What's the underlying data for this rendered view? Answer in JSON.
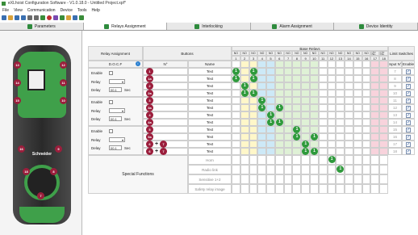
{
  "window": {
    "title": "eXLhoist Configuration Software - V1.0.18.0 - Untitled Project.xpf*"
  },
  "menu": [
    "File",
    "View",
    "Communication",
    "Device",
    "Tools",
    "Help"
  ],
  "toolbar": [
    "new-icon",
    "open-icon",
    "save-icon",
    "save-as-icon",
    "print-icon",
    "preview-icon",
    "export-icon",
    "stop-icon",
    "device-icon",
    "config-icon",
    "refresh-icon",
    "help-icon",
    "info-icon"
  ],
  "tabs": [
    "Parameters",
    "Relays Assignment",
    "Interlocking",
    "Alarm Assignment",
    "Device Identity"
  ],
  "active_tab": 1,
  "remote": {
    "brand": "Schneider",
    "left_badges": [
      "13",
      "14",
      "15",
      "16",
      "18"
    ],
    "right_badges": [
      "12",
      "11",
      "10",
      "9",
      "8"
    ],
    "center_badge": "7"
  },
  "relay_assignment": {
    "header": "Relay Assignment",
    "doc_label": "D.O.C.F",
    "groups": [
      {
        "enable": "Enable",
        "relay": "Relay",
        "delay": "Delay",
        "delay_value": "00.1",
        "unit": "Sec"
      },
      {
        "enable": "Enable",
        "relay": "Relay",
        "delay": "Delay",
        "delay_value": "00.1",
        "unit": "Sec"
      },
      {
        "enable": "Enable",
        "relay": "Relay",
        "delay": "Delay",
        "delay_value": "00.1",
        "unit": "Sec"
      }
    ]
  },
  "buttons": {
    "header": "Buttons",
    "col_no": "N°",
    "col_name": "Name",
    "rows": [
      {
        "badge": "1",
        "name": "Text"
      },
      {
        "badge": "1a",
        "name": "Text"
      },
      {
        "badge": "2",
        "name": "Text"
      },
      {
        "badge": "2a",
        "name": "Text"
      },
      {
        "badge": "3",
        "name": "Text"
      },
      {
        "badge": "3a",
        "name": "Text"
      },
      {
        "badge": "4",
        "name": "Text"
      },
      {
        "badge": "4a",
        "name": "Text"
      },
      {
        "badge": "5",
        "name": "Text"
      },
      {
        "badge": "5a",
        "name": "Text"
      },
      {
        "badge": "6",
        "plus": "+",
        "badge2": "7",
        "name": "Text"
      },
      {
        "badge": "6",
        "plus": "+",
        "badge2": "7",
        "name": "Text"
      }
    ]
  },
  "base_relays": {
    "header": "Base Relays",
    "types": [
      "NO",
      "NO",
      "NO",
      "NO",
      "NO",
      "NO",
      "NO",
      "NO",
      "NO",
      "NO",
      "NO",
      "NO",
      "NO",
      "NO",
      "NO",
      "NO",
      "NO NC",
      "NO NC"
    ],
    "numbers": [
      "1",
      "2",
      "3",
      "4",
      "5",
      "6",
      "7",
      "8",
      "9",
      "10",
      "11",
      "12",
      "13",
      "14",
      "15",
      "16",
      "17",
      "18"
    ]
  },
  "limit_switches": {
    "header": "Limit Switches",
    "col_input": "Input N°",
    "col_enable": "Enable",
    "rows": [
      {
        "input": "7",
        "enabled": true
      },
      {
        "input": "8",
        "enabled": true
      },
      {
        "input": "9",
        "enabled": true
      },
      {
        "input": "10",
        "enabled": true
      },
      {
        "input": "11",
        "enabled": true
      },
      {
        "input": "12",
        "enabled": true
      },
      {
        "input": "13",
        "enabled": true
      },
      {
        "input": "14",
        "enabled": true
      },
      {
        "input": "15",
        "enabled": true
      },
      {
        "input": "16",
        "enabled": true
      },
      {
        "input": "17",
        "enabled": true
      },
      {
        "input": "18",
        "enabled": true
      }
    ]
  },
  "special_functions": {
    "header": "Special Functions",
    "items": [
      "Horn",
      "Radio link",
      "Sensitive 1+2",
      "Safety relay image"
    ]
  },
  "colors": {
    "green": "#2f9a3c",
    "maroon": "#9b1e3c",
    "yellow_col": "#fff7c9",
    "blue_col": "#cde9f7",
    "green_col": "#dff1d6",
    "pink_col": "#f8d3dc"
  }
}
